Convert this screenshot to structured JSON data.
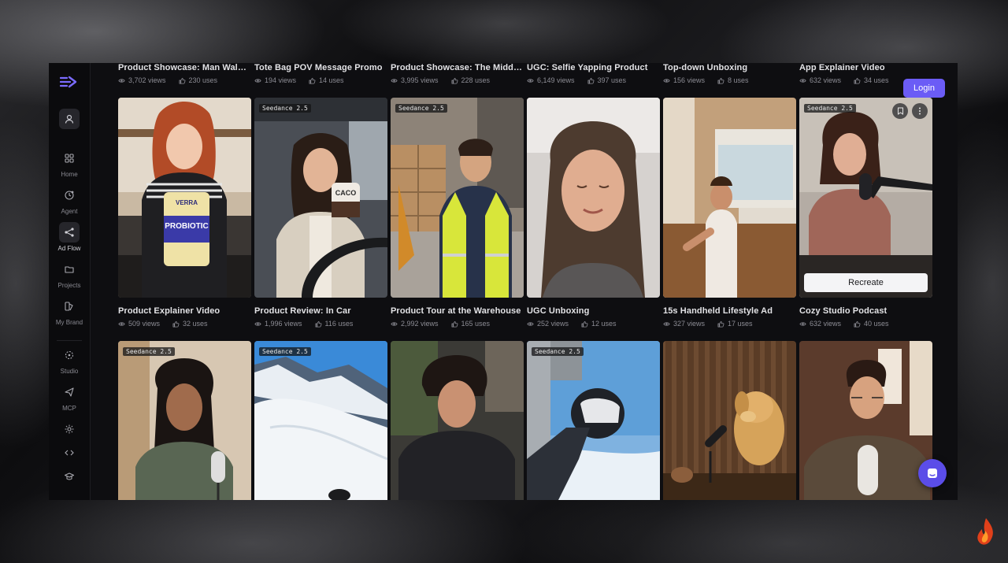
{
  "sidebar": {
    "items": [
      {
        "label": "",
        "icon": "user-icon"
      },
      {
        "label": "Home",
        "icon": "grid-icon"
      },
      {
        "label": "Agent",
        "icon": "agent-icon"
      },
      {
        "label": "Ad Flow",
        "icon": "share-nodes-icon"
      },
      {
        "label": "Projects",
        "icon": "folder-icon"
      },
      {
        "label": "My Brand",
        "icon": "palette-icon"
      },
      {
        "label": "Studio",
        "icon": "studio-icon"
      },
      {
        "label": "MCP",
        "icon": "send-icon"
      },
      {
        "label": "",
        "icon": "sparkle-icon"
      },
      {
        "label": "",
        "icon": "code-icon"
      },
      {
        "label": "",
        "icon": "graduation-cap-icon"
      }
    ]
  },
  "header": {
    "login_label": "Login"
  },
  "top_row": [
    {
      "title": "Product Showcase: Man Walki...",
      "views": "3,702 views",
      "uses": "230 uses"
    },
    {
      "title": "Tote Bag POV Message Promo",
      "views": "194 views",
      "uses": "14 uses"
    },
    {
      "title": "Product Showcase: The Middl...",
      "views": "3,995 views",
      "uses": "228 uses"
    },
    {
      "title": "UGC: Selfie Yapping Product",
      "views": "6,149 views",
      "uses": "397 uses"
    },
    {
      "title": "Top-down Unboxing",
      "views": "156 views",
      "uses": "8 uses"
    },
    {
      "title": "App Explainer Video",
      "views": "632 views",
      "uses": "34 uses"
    }
  ],
  "middle_row": [
    {
      "title": "Product Explainer Video",
      "views": "509 views",
      "uses": "32 uses",
      "badge": ""
    },
    {
      "title": "Product Review: In Car",
      "views": "1,996 views",
      "uses": "116 uses",
      "badge": "Seedance 2.5"
    },
    {
      "title": "Product Tour at the Warehouse",
      "views": "2,992 views",
      "uses": "165 uses",
      "badge": "Seedance 2.5"
    },
    {
      "title": "UGC Unboxing",
      "views": "252 views",
      "uses": "12 uses",
      "badge": ""
    },
    {
      "title": "15s Handheld Lifestyle Ad",
      "views": "327 views",
      "uses": "17 uses",
      "badge": ""
    },
    {
      "title": "Cozy Studio Podcast",
      "views": "632 views",
      "uses": "40 uses",
      "badge": "Seedance 2.5"
    }
  ],
  "bottom_row_badges": [
    "Seedance 2.5",
    "Seedance 2.5",
    "",
    "Seedance 2.5",
    "",
    ""
  ],
  "hover_card": {
    "recreate_label": "Recreate"
  },
  "thumb_text": {
    "verra": "VERRA",
    "probiotic": "PROBIOTIC",
    "caco": "CACO"
  },
  "colors": {
    "accent": "#6b5cf6",
    "chat": "#5b4de8",
    "background": "#0e0e11"
  }
}
